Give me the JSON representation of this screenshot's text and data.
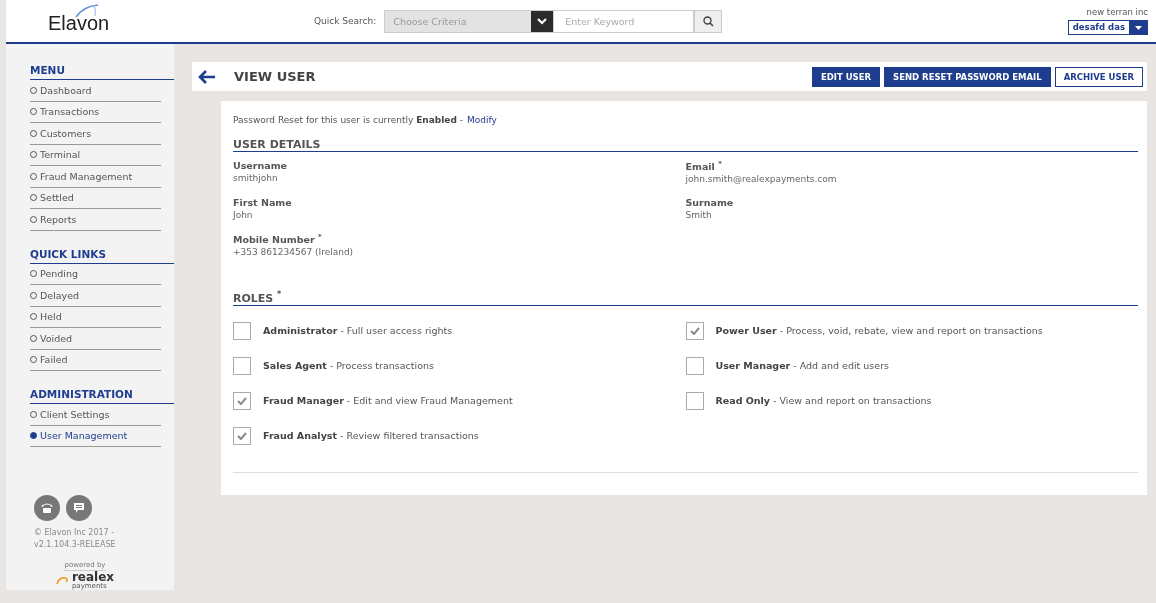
{
  "header": {
    "logo": "Elavon",
    "quick_search_label": "Quick Search:",
    "criteria": {
      "placeholder": "Choose Criteria"
    },
    "keyword": {
      "placeholder": "Enter Keyword"
    },
    "company": "new terran inc",
    "user": "desafd das"
  },
  "sidebar": {
    "sections": [
      {
        "title": "MENU",
        "items": [
          {
            "label": "Dashboard",
            "selected": false
          },
          {
            "label": "Transactions",
            "selected": false
          },
          {
            "label": "Customers",
            "selected": false
          },
          {
            "label": "Terminal",
            "selected": false
          },
          {
            "label": "Fraud Management",
            "selected": false
          },
          {
            "label": "Settled",
            "selected": false
          },
          {
            "label": "Reports",
            "selected": false
          }
        ]
      },
      {
        "title": "QUICK LINKS",
        "items": [
          {
            "label": "Pending",
            "selected": false
          },
          {
            "label": "Delayed",
            "selected": false
          },
          {
            "label": "Held",
            "selected": false
          },
          {
            "label": "Voided",
            "selected": false
          },
          {
            "label": "Failed",
            "selected": false
          }
        ]
      },
      {
        "title": "ADMINISTRATION",
        "items": [
          {
            "label": "Client Settings",
            "selected": false
          },
          {
            "label": "User Management",
            "selected": true
          }
        ]
      }
    ],
    "copyright": "© Elavon Inc 2017 - v2.1.104.3-RELEASE",
    "powered_by": "powered by",
    "brand": "realex",
    "brand_sub": "payments"
  },
  "page": {
    "title": "VIEW USER",
    "buttons": [
      {
        "label": "EDIT USER",
        "kind": "primary"
      },
      {
        "label": "SEND RESET PASSWORD EMAIL",
        "kind": "primary"
      },
      {
        "label": "ARCHIVE USER",
        "kind": "outline"
      }
    ]
  },
  "notice": {
    "text": "Password Reset for this user is currently **Enabled** - ",
    "link": "Modify"
  },
  "user_details": {
    "title": "USER DETAILS",
    "fields": [
      {
        "label": "Username",
        "value": "smithjohn"
      },
      {
        "label": "Email $^{*}$",
        "value": "john.smith@realexpayments.com"
      },
      {
        "label": "First Name",
        "value": "John"
      },
      {
        "label": "Surname",
        "value": "Smith"
      },
      {
        "label": "Mobile Number $^{*}$",
        "value": "+353 861234567 (Ireland)"
      }
    ]
  },
  "roles": {
    "title": "ROLES $^{*}$",
    "items": [
      {
        "text": "**Administrator** - Full user access rights",
        "checked": false
      },
      {
        "text": "**Power User** - Process, void, rebate, view and report on transactions",
        "checked": true
      },
      {
        "text": "**Sales Agent** - Process transactions",
        "checked": false
      },
      {
        "text": "**User Manager** - Add and edit users",
        "checked": false
      },
      {
        "text": "**Fraud Manager** - Edit and view Fraud Management",
        "checked": true
      },
      {
        "text": "**Read Only** - View and report on transactions",
        "checked": false
      },
      {
        "text": "**Fraud Analyst** - Review filtered transactions",
        "checked": true
      }
    ]
  }
}
